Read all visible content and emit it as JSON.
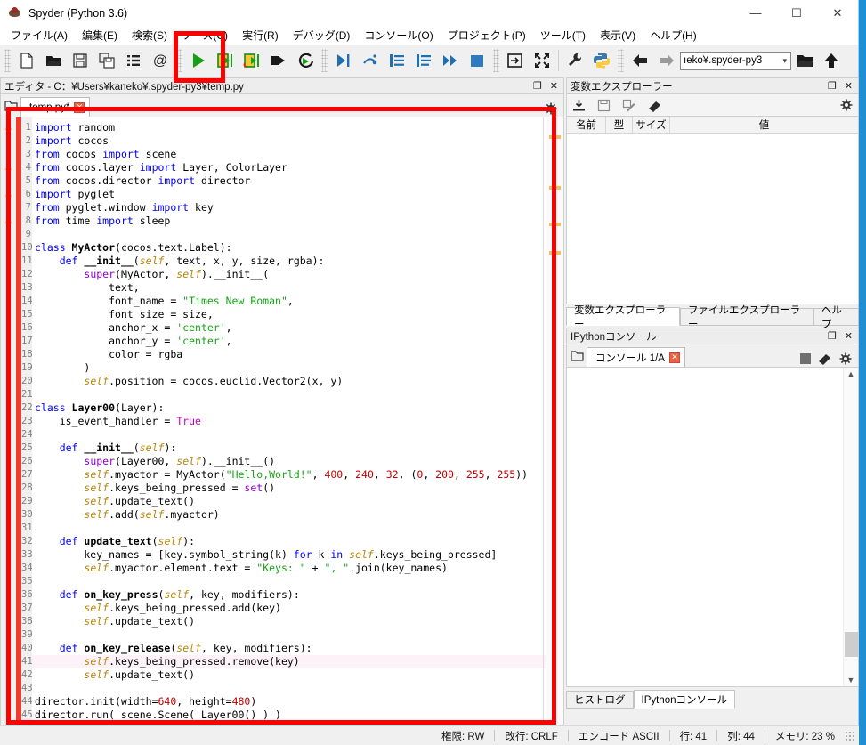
{
  "window": {
    "title": "Spyder (Python 3.6)",
    "icon": "spyder-icon",
    "minimize": "—",
    "maximize": "☐",
    "close": "✕"
  },
  "menubar": {
    "items": [
      {
        "label": "ファイル(A)"
      },
      {
        "label": "編集(E)"
      },
      {
        "label": "検索(S)"
      },
      {
        "label": "ソース(C)"
      },
      {
        "label": "実行(R)"
      },
      {
        "label": "デバッグ(D)"
      },
      {
        "label": "コンソール(O)"
      },
      {
        "label": "プロジェクト(P)"
      },
      {
        "label": "ツール(T)"
      },
      {
        "label": "表示(V)"
      },
      {
        "label": "ヘルプ(H)"
      }
    ]
  },
  "toolbar": {
    "path_value": "ıeko¥.spyder-py3",
    "icons": [
      "new-file-icon",
      "open-file-icon",
      "save-file-icon",
      "save-all-icon",
      "file-list-icon",
      "at-sign-icon",
      "run-file-icon",
      "run-cell-icon",
      "run-cell-advance-icon",
      "run-selection-icon",
      "rerun-icon",
      "debug-icon",
      "step-over-icon",
      "step-into-icon",
      "step-return-icon",
      "continue-icon",
      "stop-icon",
      "maximize-pane-icon",
      "fullscreen-icon",
      "preferences-icon",
      "pythonpath-icon",
      "back-icon",
      "forward-icon",
      "browse-dir-icon",
      "parent-dir-icon"
    ]
  },
  "editor": {
    "pane_title": "エディタ - C：¥Users¥kaneko¥.spyder-py3¥temp.py",
    "tab_label": "temp.py*",
    "tab_close": "✕",
    "undock": "❐",
    "close": "✕",
    "current_line": 41,
    "warning_lines": [
      1,
      4,
      6,
      8
    ],
    "flag_positions": [
      20,
      77,
      118,
      150
    ],
    "lines": [
      {
        "n": 1,
        "tokens": [
          {
            "t": "import ",
            "c": "kw"
          },
          {
            "t": "random",
            "c": ""
          }
        ]
      },
      {
        "n": 2,
        "tokens": [
          {
            "t": "import ",
            "c": "kw"
          },
          {
            "t": "cocos",
            "c": ""
          }
        ]
      },
      {
        "n": 3,
        "tokens": [
          {
            "t": "from ",
            "c": "kw"
          },
          {
            "t": "cocos ",
            "c": ""
          },
          {
            "t": "import ",
            "c": "kw"
          },
          {
            "t": "scene",
            "c": ""
          }
        ]
      },
      {
        "n": 4,
        "tokens": [
          {
            "t": "from ",
            "c": "kw"
          },
          {
            "t": "cocos.layer ",
            "c": ""
          },
          {
            "t": "import ",
            "c": "kw"
          },
          {
            "t": "Layer, ColorLayer",
            "c": ""
          }
        ]
      },
      {
        "n": 5,
        "tokens": [
          {
            "t": "from ",
            "c": "kw"
          },
          {
            "t": "cocos.director ",
            "c": ""
          },
          {
            "t": "import ",
            "c": "kw"
          },
          {
            "t": "director",
            "c": ""
          }
        ]
      },
      {
        "n": 6,
        "tokens": [
          {
            "t": "import ",
            "c": "kw"
          },
          {
            "t": "pyglet",
            "c": ""
          }
        ]
      },
      {
        "n": 7,
        "tokens": [
          {
            "t": "from ",
            "c": "kw"
          },
          {
            "t": "pyglet.window ",
            "c": ""
          },
          {
            "t": "import ",
            "c": "kw"
          },
          {
            "t": "key",
            "c": ""
          }
        ]
      },
      {
        "n": 8,
        "tokens": [
          {
            "t": "from ",
            "c": "kw"
          },
          {
            "t": "time ",
            "c": ""
          },
          {
            "t": "import ",
            "c": "kw"
          },
          {
            "t": "sleep",
            "c": ""
          }
        ]
      },
      {
        "n": 9,
        "tokens": []
      },
      {
        "n": 10,
        "tokens": [
          {
            "t": "class ",
            "c": "kw"
          },
          {
            "t": "MyActor",
            "c": "cls"
          },
          {
            "t": "(cocos.text.Label):",
            "c": ""
          }
        ]
      },
      {
        "n": 11,
        "tokens": [
          {
            "t": "    ",
            "c": ""
          },
          {
            "t": "def ",
            "c": "kw"
          },
          {
            "t": "__init__",
            "c": "def"
          },
          {
            "t": "(",
            "c": ""
          },
          {
            "t": "self",
            "c": "self"
          },
          {
            "t": ", text, x, y, size, rgba):",
            "c": ""
          }
        ]
      },
      {
        "n": 12,
        "tokens": [
          {
            "t": "        ",
            "c": ""
          },
          {
            "t": "super",
            "c": "bi"
          },
          {
            "t": "(MyActor, ",
            "c": ""
          },
          {
            "t": "self",
            "c": "self"
          },
          {
            "t": ").__init__(",
            "c": ""
          }
        ]
      },
      {
        "n": 13,
        "tokens": [
          {
            "t": "            text,",
            "c": ""
          }
        ]
      },
      {
        "n": 14,
        "tokens": [
          {
            "t": "            font_name = ",
            "c": ""
          },
          {
            "t": "\"Times New Roman\"",
            "c": "str"
          },
          {
            "t": ",",
            "c": ""
          }
        ]
      },
      {
        "n": 15,
        "tokens": [
          {
            "t": "            font_size = size,",
            "c": ""
          }
        ]
      },
      {
        "n": 16,
        "tokens": [
          {
            "t": "            anchor_x = ",
            "c": ""
          },
          {
            "t": "'center'",
            "c": "str"
          },
          {
            "t": ",",
            "c": ""
          }
        ]
      },
      {
        "n": 17,
        "tokens": [
          {
            "t": "            anchor_y = ",
            "c": ""
          },
          {
            "t": "'center'",
            "c": "str"
          },
          {
            "t": ",",
            "c": ""
          }
        ]
      },
      {
        "n": 18,
        "tokens": [
          {
            "t": "            color = rgba",
            "c": ""
          }
        ]
      },
      {
        "n": 19,
        "tokens": [
          {
            "t": "        )",
            "c": ""
          }
        ]
      },
      {
        "n": 20,
        "tokens": [
          {
            "t": "        ",
            "c": ""
          },
          {
            "t": "self",
            "c": "self"
          },
          {
            "t": ".position = cocos.euclid.Vector2(x, y)",
            "c": ""
          }
        ]
      },
      {
        "n": 21,
        "tokens": []
      },
      {
        "n": 22,
        "tokens": [
          {
            "t": "class ",
            "c": "kw"
          },
          {
            "t": "Layer00",
            "c": "cls"
          },
          {
            "t": "(Layer):",
            "c": ""
          }
        ]
      },
      {
        "n": 23,
        "tokens": [
          {
            "t": "    is_event_handler = ",
            "c": ""
          },
          {
            "t": "True",
            "c": "tru"
          }
        ]
      },
      {
        "n": 24,
        "tokens": []
      },
      {
        "n": 25,
        "tokens": [
          {
            "t": "    ",
            "c": ""
          },
          {
            "t": "def ",
            "c": "kw"
          },
          {
            "t": "__init__",
            "c": "def"
          },
          {
            "t": "(",
            "c": ""
          },
          {
            "t": "self",
            "c": "self"
          },
          {
            "t": "):",
            "c": ""
          }
        ]
      },
      {
        "n": 26,
        "tokens": [
          {
            "t": "        ",
            "c": ""
          },
          {
            "t": "super",
            "c": "bi"
          },
          {
            "t": "(Layer00, ",
            "c": ""
          },
          {
            "t": "self",
            "c": "self"
          },
          {
            "t": ").__init__()",
            "c": ""
          }
        ]
      },
      {
        "n": 27,
        "tokens": [
          {
            "t": "        ",
            "c": ""
          },
          {
            "t": "self",
            "c": "self"
          },
          {
            "t": ".myactor = MyActor(",
            "c": ""
          },
          {
            "t": "\"Hello,World!\"",
            "c": "str"
          },
          {
            "t": ", ",
            "c": ""
          },
          {
            "t": "400",
            "c": "num"
          },
          {
            "t": ", ",
            "c": ""
          },
          {
            "t": "240",
            "c": "num"
          },
          {
            "t": ", ",
            "c": ""
          },
          {
            "t": "32",
            "c": "num"
          },
          {
            "t": ", (",
            "c": ""
          },
          {
            "t": "0",
            "c": "num"
          },
          {
            "t": ", ",
            "c": ""
          },
          {
            "t": "200",
            "c": "num"
          },
          {
            "t": ", ",
            "c": ""
          },
          {
            "t": "255",
            "c": "num"
          },
          {
            "t": ", ",
            "c": ""
          },
          {
            "t": "255",
            "c": "num"
          },
          {
            "t": "))",
            "c": ""
          }
        ]
      },
      {
        "n": 28,
        "tokens": [
          {
            "t": "        ",
            "c": ""
          },
          {
            "t": "self",
            "c": "self"
          },
          {
            "t": ".keys_being_pressed = ",
            "c": ""
          },
          {
            "t": "set",
            "c": "bi"
          },
          {
            "t": "()",
            "c": ""
          }
        ]
      },
      {
        "n": 29,
        "tokens": [
          {
            "t": "        ",
            "c": ""
          },
          {
            "t": "self",
            "c": "self"
          },
          {
            "t": ".update_text()",
            "c": ""
          }
        ]
      },
      {
        "n": 30,
        "tokens": [
          {
            "t": "        ",
            "c": ""
          },
          {
            "t": "self",
            "c": "self"
          },
          {
            "t": ".add(",
            "c": ""
          },
          {
            "t": "self",
            "c": "self"
          },
          {
            "t": ".myactor)",
            "c": ""
          }
        ]
      },
      {
        "n": 31,
        "tokens": []
      },
      {
        "n": 32,
        "tokens": [
          {
            "t": "    ",
            "c": ""
          },
          {
            "t": "def ",
            "c": "kw"
          },
          {
            "t": "update_text",
            "c": "def"
          },
          {
            "t": "(",
            "c": ""
          },
          {
            "t": "self",
            "c": "self"
          },
          {
            "t": "):",
            "c": ""
          }
        ]
      },
      {
        "n": 33,
        "tokens": [
          {
            "t": "        key_names = [key.symbol_string(k) ",
            "c": ""
          },
          {
            "t": "for ",
            "c": "kw"
          },
          {
            "t": "k ",
            "c": ""
          },
          {
            "t": "in ",
            "c": "kw"
          },
          {
            "t": "self",
            "c": "self"
          },
          {
            "t": ".keys_being_pressed]",
            "c": ""
          }
        ]
      },
      {
        "n": 34,
        "tokens": [
          {
            "t": "        ",
            "c": ""
          },
          {
            "t": "self",
            "c": "self"
          },
          {
            "t": ".myactor.element.text = ",
            "c": ""
          },
          {
            "t": "\"Keys: \"",
            "c": "str"
          },
          {
            "t": " + ",
            "c": ""
          },
          {
            "t": "\", \"",
            "c": "str"
          },
          {
            "t": ".join(key_names)",
            "c": ""
          }
        ]
      },
      {
        "n": 35,
        "tokens": []
      },
      {
        "n": 36,
        "tokens": [
          {
            "t": "    ",
            "c": ""
          },
          {
            "t": "def ",
            "c": "kw"
          },
          {
            "t": "on_key_press",
            "c": "def"
          },
          {
            "t": "(",
            "c": ""
          },
          {
            "t": "self",
            "c": "self"
          },
          {
            "t": ", key, modifiers):",
            "c": ""
          }
        ]
      },
      {
        "n": 37,
        "tokens": [
          {
            "t": "        ",
            "c": ""
          },
          {
            "t": "self",
            "c": "self"
          },
          {
            "t": ".keys_being_pressed.add(key)",
            "c": ""
          }
        ]
      },
      {
        "n": 38,
        "tokens": [
          {
            "t": "        ",
            "c": ""
          },
          {
            "t": "self",
            "c": "self"
          },
          {
            "t": ".update_text()",
            "c": ""
          }
        ]
      },
      {
        "n": 39,
        "tokens": []
      },
      {
        "n": 40,
        "tokens": [
          {
            "t": "    ",
            "c": ""
          },
          {
            "t": "def ",
            "c": "kw"
          },
          {
            "t": "on_key_release",
            "c": "def"
          },
          {
            "t": "(",
            "c": ""
          },
          {
            "t": "self",
            "c": "self"
          },
          {
            "t": ", key, modifiers):",
            "c": ""
          }
        ]
      },
      {
        "n": 41,
        "tokens": [
          {
            "t": "        ",
            "c": ""
          },
          {
            "t": "self",
            "c": "self"
          },
          {
            "t": ".keys_being_pressed.remove(key)",
            "c": ""
          }
        ]
      },
      {
        "n": 42,
        "tokens": [
          {
            "t": "        ",
            "c": ""
          },
          {
            "t": "self",
            "c": "self"
          },
          {
            "t": ".update_text()",
            "c": ""
          }
        ]
      },
      {
        "n": 43,
        "tokens": []
      },
      {
        "n": 44,
        "tokens": [
          {
            "t": "director.init(width=",
            "c": ""
          },
          {
            "t": "640",
            "c": "num"
          },
          {
            "t": ", height=",
            "c": ""
          },
          {
            "t": "480",
            "c": "num"
          },
          {
            "t": ")",
            "c": ""
          }
        ]
      },
      {
        "n": 45,
        "tokens": [
          {
            "t": "director.run( scene.Scene( Layer00() ) )",
            "c": ""
          }
        ]
      }
    ]
  },
  "variable_explorer": {
    "pane_title": "変数エクスプローラー",
    "undock": "❐",
    "close": "✕",
    "toolbar_icons": [
      "import-data-icon",
      "save-data-icon",
      "save-as-icon",
      "clear-variables-icon",
      "options-icon"
    ],
    "columns": [
      "名前",
      "型",
      "サイズ",
      "値"
    ],
    "rows": []
  },
  "dock_tabs": [
    {
      "label": "変数エクスプローラー",
      "active": true
    },
    {
      "label": "ファイルエクスプローラー",
      "active": false
    },
    {
      "label": "ヘルプ",
      "active": false
    }
  ],
  "console": {
    "pane_title": "IPythonコンソール",
    "undock": "❐",
    "close": "✕",
    "tab_label": "コンソール 1/A",
    "tab_close": "✕",
    "toolbar_icons": [
      "stop-icon",
      "clear-console-icon",
      "options-icon"
    ],
    "content": ""
  },
  "console_tabs": [
    {
      "label": "ヒストログ",
      "active": false
    },
    {
      "label": "IPythonコンソール",
      "active": true
    }
  ],
  "statusbar": {
    "permission": "権限: RW",
    "eol": "改行: CRLF",
    "encoding": "エンコード ASCII",
    "line": "行: 41",
    "column": "列: 44",
    "memory": "メモリ: 23 %"
  },
  "annotations": {
    "color": "#fe0000",
    "run_button_box": "highlight-run-button",
    "editor_box": "highlight-editor-area"
  }
}
